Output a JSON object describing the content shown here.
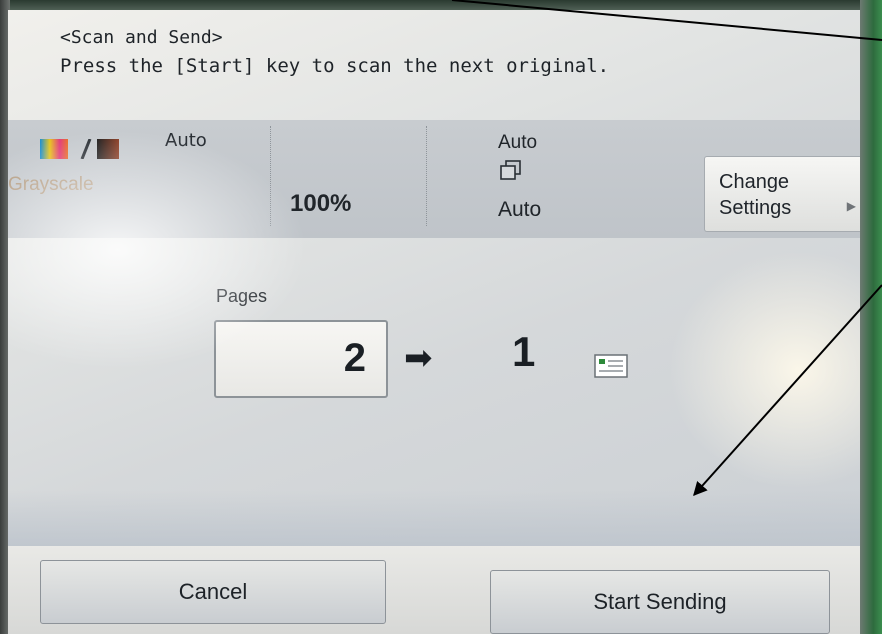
{
  "header": {
    "title": "<Scan and Send>",
    "instruction": "Press the [Start] key to scan the next original."
  },
  "settings": {
    "color_mode_label": "Auto",
    "color_mode_value": "Grayscale",
    "zoom": "100%",
    "sides_original": "Auto",
    "sides_output": "Auto",
    "change_settings_line1": "Change",
    "change_settings_line2": "Settings"
  },
  "pages": {
    "label": "Pages",
    "scanned": "2",
    "result": "1"
  },
  "buttons": {
    "cancel": "Cancel",
    "start_sending": "Start Sending"
  },
  "icons": {
    "color_mode": "color-grayscale-icon",
    "duplex": "duplex-icon",
    "arrow": "arrow-right-icon",
    "document": "document-icon"
  },
  "colors": {
    "screen_background": "#d5d8da",
    "grayscale_text": "#b29a7f"
  }
}
